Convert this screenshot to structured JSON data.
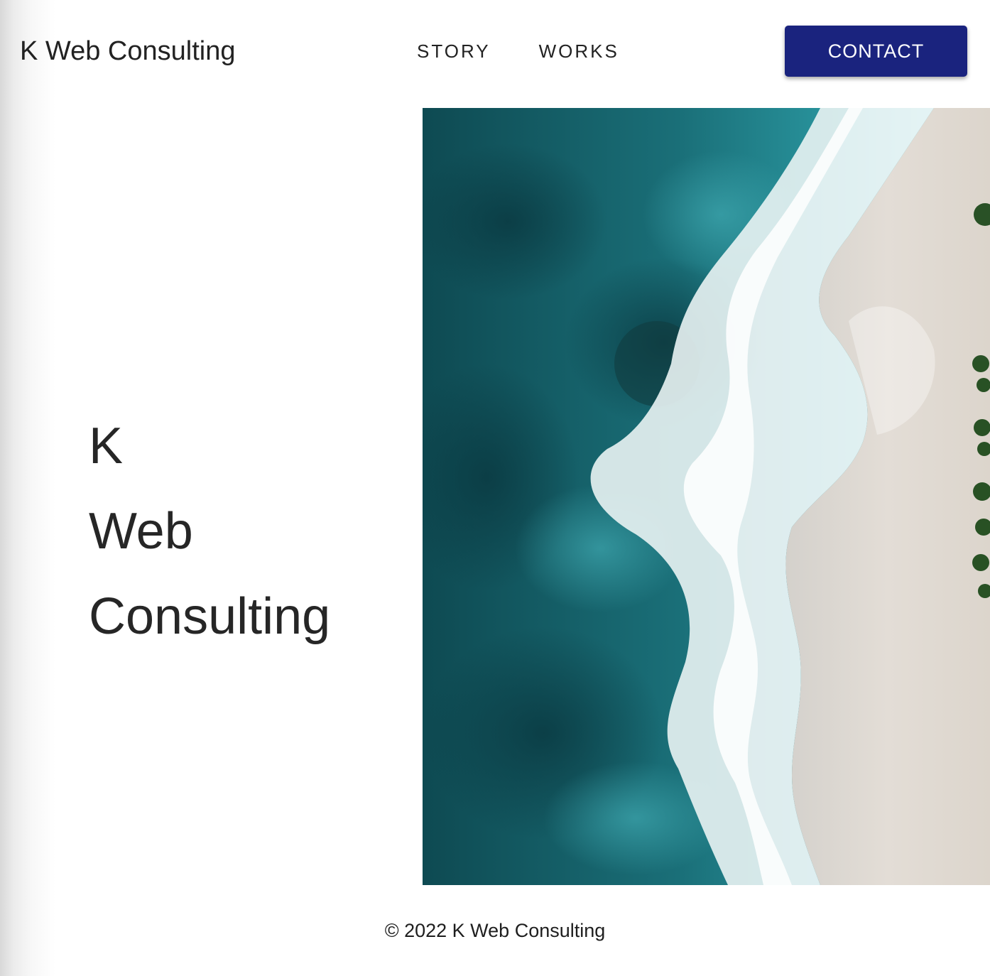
{
  "header": {
    "brand": "K Web Consulting",
    "nav": [
      {
        "label": "STORY"
      },
      {
        "label": "WORKS"
      }
    ],
    "contact_label": "CONTACT"
  },
  "hero": {
    "title_lines": [
      "K",
      "Web",
      "Consulting"
    ],
    "image_icon": "aerial-ocean-beach-image"
  },
  "footer": {
    "copyright": "© 2022 K Web Consulting"
  },
  "colors": {
    "accent": "#1a237e",
    "text": "#222222",
    "ocean_deep": "#0f4f57",
    "ocean_mid": "#1d7d87",
    "sand": "#e2ddd7"
  }
}
